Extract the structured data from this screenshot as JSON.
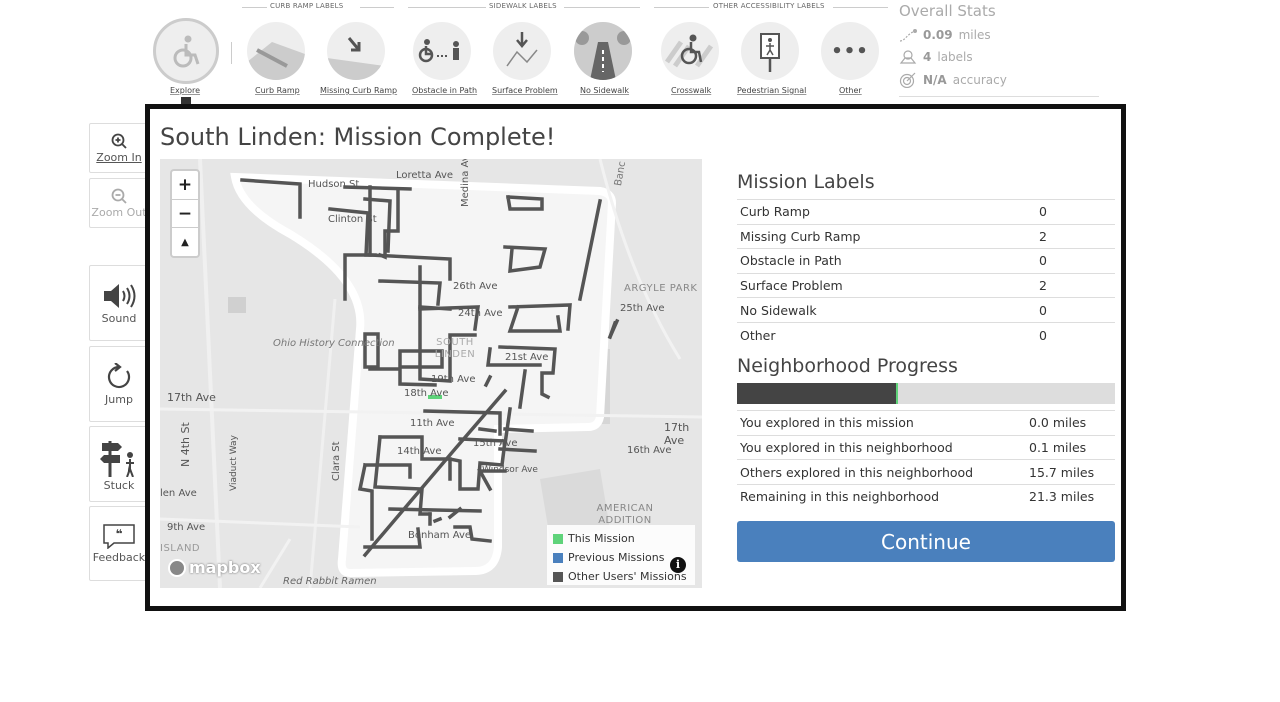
{
  "toolbar": {
    "groups": {
      "curb_ramp_labels": "CURB RAMP LABELS",
      "sidewalk_labels": "SIDEWALK LABELS",
      "other_accessibility_labels": "OTHER ACCESSIBILITY LABELS"
    },
    "explore_label": "Explore",
    "tools": [
      {
        "label": "Curb Ramp",
        "icon": "curb-ramp-icon"
      },
      {
        "label": "Missing Curb Ramp",
        "icon": "missing-curb-ramp-icon"
      },
      {
        "label": "Obstacle in Path",
        "icon": "obstacle-icon"
      },
      {
        "label": "Surface Problem",
        "icon": "surface-problem-icon"
      },
      {
        "label": "No Sidewalk",
        "icon": "no-sidewalk-icon"
      },
      {
        "label": "Crosswalk",
        "icon": "crosswalk-icon"
      },
      {
        "label": "Pedestrian Signal",
        "icon": "pedestrian-signal-icon"
      },
      {
        "label": "Other",
        "icon": "more-icon"
      }
    ]
  },
  "stats": {
    "title": "Overall Stats",
    "miles_value": "0.09",
    "miles_unit": "miles",
    "labels_value": "4",
    "labels_unit": "labels",
    "accuracy_value": "N/A",
    "accuracy_unit": "accuracy"
  },
  "sidebar": {
    "zoom_in": "Zoom In",
    "zoom_out": "Zoom Out",
    "sound": "Sound",
    "jump": "Jump",
    "stuck": "Stuck",
    "feedback": "Feedback"
  },
  "modal": {
    "title": "South Linden: Mission Complete!",
    "mission_labels_title": "Mission Labels",
    "mission_labels": [
      {
        "label": "Curb Ramp",
        "value": "0"
      },
      {
        "label": "Missing Curb Ramp",
        "value": "2"
      },
      {
        "label": "Obstacle in Path",
        "value": "0"
      },
      {
        "label": "Surface Problem",
        "value": "2"
      },
      {
        "label": "No Sidewalk",
        "value": "0"
      },
      {
        "label": "Other",
        "value": "0"
      }
    ],
    "progress_title": "Neighborhood Progress",
    "progress_fraction": 0.42,
    "progress_rows": [
      {
        "label": "You explored in this mission",
        "value": "0.0 miles"
      },
      {
        "label": "You explored in this neighborhood",
        "value": "0.1 miles"
      },
      {
        "label": "Others explored in this neighborhood",
        "value": "15.7 miles"
      },
      {
        "label": "Remaining in this neighborhood",
        "value": "21.3 miles"
      }
    ],
    "continue_label": "Continue"
  },
  "map": {
    "streets": [
      "Hudson St",
      "Loretta Ave",
      "Medina Ave",
      "Clinton St",
      "26th Ave",
      "24th Ave",
      "25th Ave",
      "21st Ave",
      "19th Ave",
      "18th Ave",
      "17th Ave",
      "17th Ave",
      "16th Ave",
      "15th Ave",
      "14th Ave",
      "11th Ave",
      "Windsor Ave",
      "Bonham Ave",
      "Clara St",
      "N 4th St",
      "Viaduct Way",
      "9th Ave",
      "Banc",
      "len Ave",
      "Red Rabbit Ramen"
    ],
    "areas": [
      "ARGYLE PARK",
      "SOUTH LINDEN",
      "AMERICAN ADDITION",
      "ISLAND",
      "Ohio History Connection"
    ],
    "legend": [
      {
        "label": "This Mission",
        "color": "#5fd37a"
      },
      {
        "label": "Previous Missions",
        "color": "#4a80bd"
      },
      {
        "label": "Other Users' Missions",
        "color": "#555555"
      }
    ],
    "attribution": "mapbox"
  }
}
